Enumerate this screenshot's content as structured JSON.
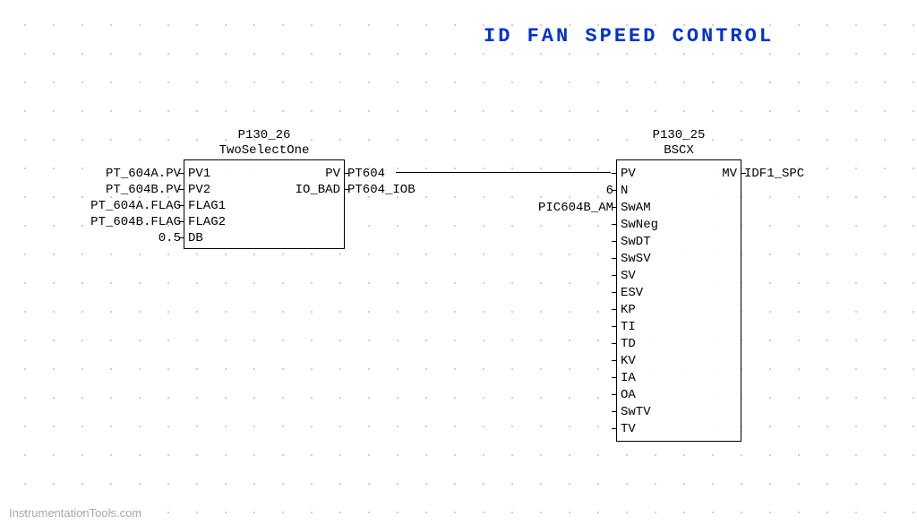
{
  "title": "ID FAN SPEED CONTROL",
  "watermark": "InstrumentationTools.com",
  "block1": {
    "id": "P130_26",
    "type": "TwoSelectOne",
    "inputs": {
      "pv1": {
        "label": "PV1",
        "signal": "PT_604A.PV"
      },
      "pv2": {
        "label": "PV2",
        "signal": "PT_604B.PV"
      },
      "flag1": {
        "label": "FLAG1",
        "signal": "PT_604A.FLAG"
      },
      "flag2": {
        "label": "FLAG2",
        "signal": "PT_604B.FLAG"
      },
      "db": {
        "label": "DB",
        "signal": "0.5"
      }
    },
    "outputs": {
      "pv": {
        "label": "PV",
        "signal": "PT604"
      },
      "iobad": {
        "label": "IO_BAD",
        "signal": "PT604_IOB"
      }
    }
  },
  "block2": {
    "id": "P130_25",
    "type": "BSCX",
    "inputs": {
      "pv": {
        "label": "PV",
        "signal": ""
      },
      "n": {
        "label": "N",
        "signal": "6"
      },
      "swam": {
        "label": "SwAM",
        "signal": "PIC604B_AM"
      },
      "swneg": {
        "label": "SwNeg",
        "signal": ""
      },
      "swdt": {
        "label": "SwDT",
        "signal": ""
      },
      "swsv": {
        "label": "SwSV",
        "signal": ""
      },
      "sv": {
        "label": "SV",
        "signal": ""
      },
      "esv": {
        "label": "ESV",
        "signal": ""
      },
      "kp": {
        "label": "KP",
        "signal": ""
      },
      "ti": {
        "label": "TI",
        "signal": ""
      },
      "td": {
        "label": "TD",
        "signal": ""
      },
      "kv": {
        "label": "KV",
        "signal": ""
      },
      "ia": {
        "label": "IA",
        "signal": ""
      },
      "oa": {
        "label": "OA",
        "signal": ""
      },
      "swtv": {
        "label": "SwTV",
        "signal": ""
      },
      "tv": {
        "label": "TV",
        "signal": ""
      }
    },
    "outputs": {
      "mv": {
        "label": "MV",
        "signal": "IDF1_SPC"
      }
    }
  }
}
